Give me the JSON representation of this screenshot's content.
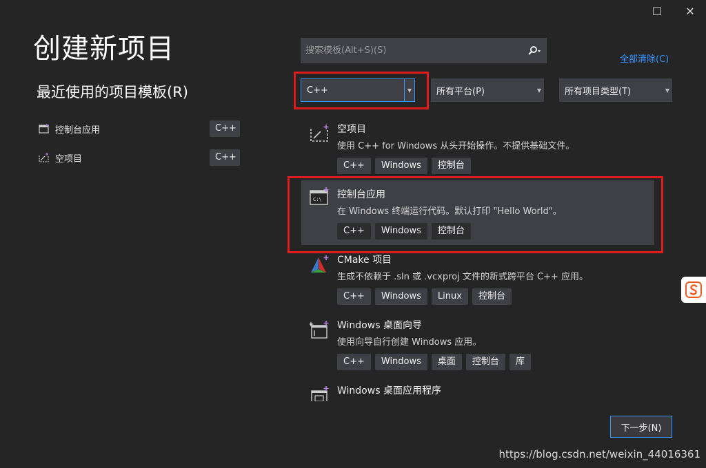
{
  "window": {
    "maximize_glyph": "☐",
    "close_glyph": "✕"
  },
  "page": {
    "title": "创建新项目",
    "clear_all": "全部清除(C)"
  },
  "recent": {
    "title": "最近使用的项目模板(R)",
    "items": [
      {
        "label": "控制台应用",
        "tag": "C++",
        "icon": "console-app-icon"
      },
      {
        "label": "空项目",
        "tag": "C++",
        "icon": "empty-project-icon"
      }
    ]
  },
  "search": {
    "placeholder": "搜索模板(Alt+S)(S)",
    "value": ""
  },
  "filters": {
    "language": "C++",
    "platform": "所有平台(P)",
    "project_type": "所有项目类型(T)"
  },
  "templates": [
    {
      "name": "空项目",
      "description": "使用 C++ for Windows 从头开始操作。不提供基础文件。",
      "tags": [
        "C++",
        "Windows",
        "控制台"
      ],
      "icon": "empty-project-icon"
    },
    {
      "name": "控制台应用",
      "description": "在 Windows 终端运行代码。默认打印 \"Hello World\"。",
      "tags": [
        "C++",
        "Windows",
        "控制台"
      ],
      "icon": "console-app-icon",
      "selected": true
    },
    {
      "name": "CMake 项目",
      "description": "生成不依赖于 .sln 或 .vcxproj 文件的新式跨平台 C++ 应用。",
      "tags": [
        "C++",
        "Windows",
        "Linux",
        "控制台"
      ],
      "icon": "cmake-icon"
    },
    {
      "name": "Windows 桌面向导",
      "description": "使用向导自行创建 Windows 应用。",
      "tags": [
        "C++",
        "Windows",
        "桌面",
        "控制台",
        "库"
      ],
      "icon": "desktop-wizard-icon"
    },
    {
      "name": "Windows 桌面应用程序",
      "description": "",
      "tags": [],
      "icon": "desktop-app-icon"
    }
  ],
  "buttons": {
    "next": "下一步(N)"
  },
  "watermark": "https://blog.csdn.net/weixin_44016361",
  "colors": {
    "background": "#252526",
    "accent": "#3794ff",
    "highlight_red": "#e21b1f"
  }
}
